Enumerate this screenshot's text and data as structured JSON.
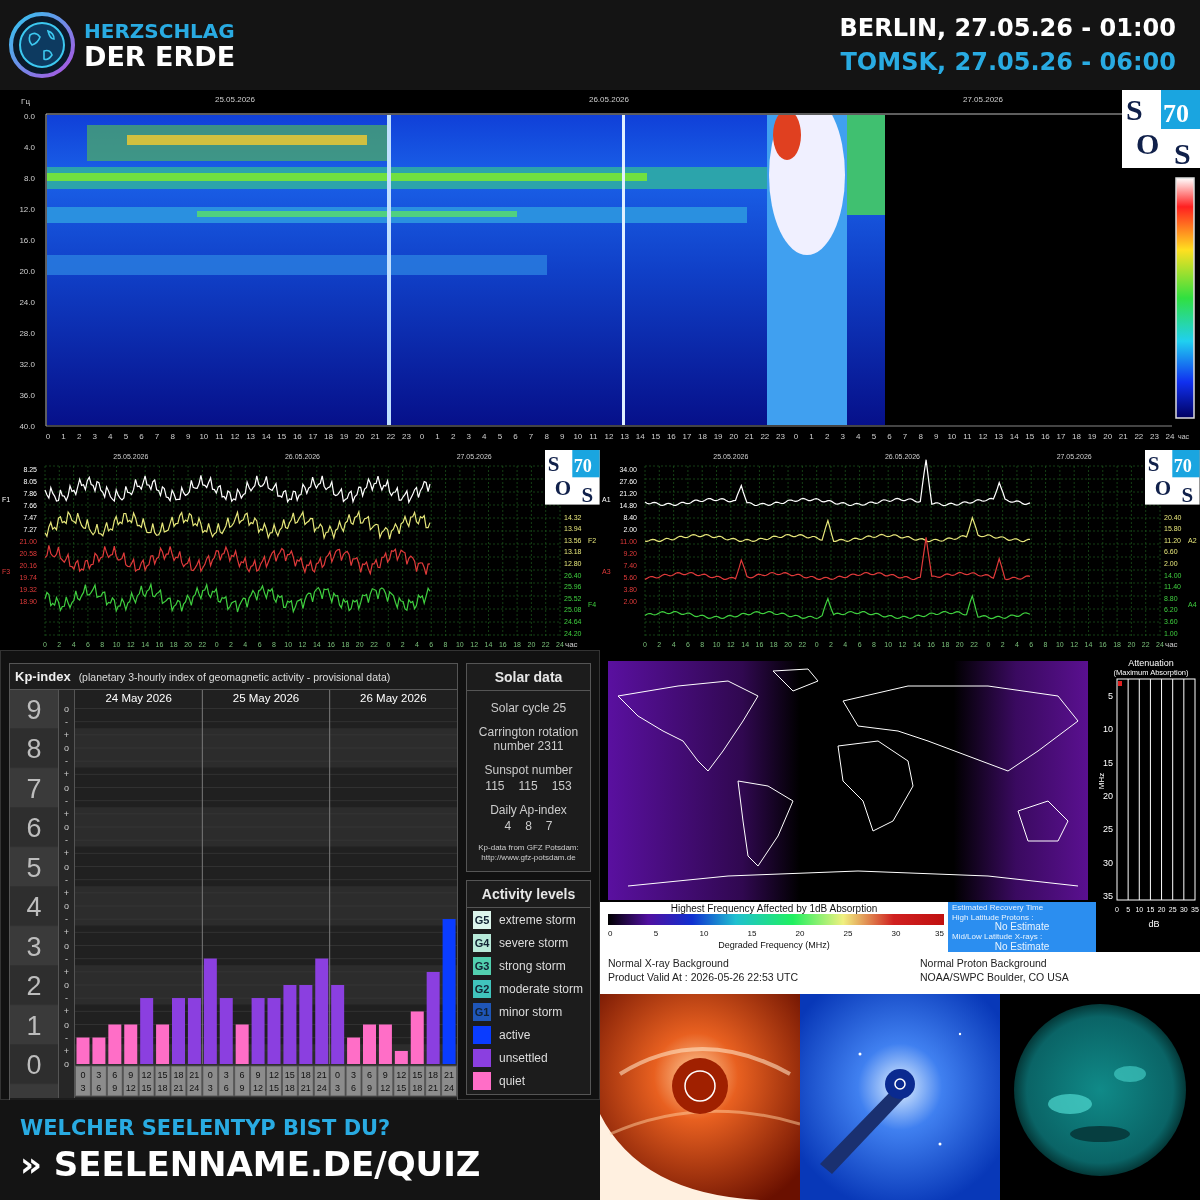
{
  "header": {
    "logo_lines": [
      "HERZSCHLAG",
      "DER ERDE"
    ],
    "times": [
      {
        "text": "BERLIN, 27.05.26 - 01:00",
        "color": "#ffffff"
      },
      {
        "text": "TOMSK, 27.05.26 - 06:00",
        "color": "#29abe2"
      }
    ]
  },
  "spectrogram": {
    "unit": "Гц",
    "dates": [
      "25.05.2026",
      "26.05.2026",
      "27.05.2026"
    ],
    "yticks": [
      "0.0",
      "4.0",
      "8.0",
      "12.0",
      "16.0",
      "20.0",
      "24.0",
      "28.0",
      "32.0",
      "36.0",
      "40.0"
    ],
    "xticks": [
      "0",
      "1",
      "2",
      "3",
      "4",
      "5",
      "6",
      "7",
      "8",
      "9",
      "10",
      "11",
      "12",
      "13",
      "14",
      "15",
      "16",
      "17",
      "18",
      "19",
      "20",
      "21",
      "22",
      "23",
      "0",
      "1",
      "2",
      "3",
      "4",
      "5",
      "6",
      "7",
      "8",
      "9",
      "10",
      "11",
      "12",
      "13",
      "14",
      "15",
      "16",
      "17",
      "18",
      "19",
      "20",
      "21",
      "22",
      "23",
      "0",
      "1",
      "2",
      "3",
      "4",
      "5",
      "6",
      "7",
      "8",
      "9",
      "10",
      "11",
      "12",
      "13",
      "14",
      "15",
      "16",
      "17",
      "18",
      "19",
      "20",
      "21",
      "22",
      "23",
      "24"
    ],
    "xunit": "час",
    "logo": [
      "S",
      "70",
      "O",
      "S"
    ]
  },
  "signal_charts": [
    {
      "dates": [
        "25.05.2026",
        "26.05.2026",
        "27.05.2026"
      ],
      "left_axes": [
        {
          "label": "F1",
          "color": "#ffffff",
          "ticks": [
            "8.25",
            "8.05",
            "7.86",
            "7.66",
            "7.47",
            "7.27"
          ]
        },
        {
          "label": "F3",
          "color": "#e03a3a",
          "ticks": [
            "21.00",
            "20.58",
            "20.16",
            "19.74",
            "19.32",
            "18.90"
          ]
        }
      ],
      "right_axes": [
        {
          "label": "F2",
          "color": "#e6e67a",
          "ticks": [
            "14.32",
            "13.94",
            "13.56",
            "13.18",
            "12.80"
          ]
        },
        {
          "label": "F4",
          "color": "#3fcf3f",
          "ticks": [
            "26.40",
            "25.96",
            "25.52",
            "25.08",
            "24.64",
            "24.20"
          ]
        }
      ],
      "xticks": [
        "0",
        "2",
        "4",
        "6",
        "8",
        "10",
        "12",
        "14",
        "16",
        "18",
        "20",
        "22",
        "0",
        "2",
        "4",
        "6",
        "8",
        "10",
        "12",
        "14",
        "16",
        "18",
        "20",
        "22",
        "0",
        "2",
        "4",
        "6",
        "8",
        "10",
        "12",
        "14",
        "16",
        "18",
        "20",
        "22",
        "24"
      ],
      "xunit": "час",
      "logo": [
        "S",
        "70",
        "O",
        "S"
      ]
    },
    {
      "dates": [
        "25.05.2026",
        "26.05.2026",
        "27.05.2026"
      ],
      "left_axes": [
        {
          "label": "A1",
          "color": "#ffffff",
          "ticks": [
            "34.00",
            "27.60",
            "21.20",
            "14.80",
            "8.40",
            "2.00"
          ]
        },
        {
          "label": "A3",
          "color": "#e03a3a",
          "ticks": [
            "11.00",
            "9.20",
            "7.40",
            "5.60",
            "3.80",
            "2.00"
          ]
        }
      ],
      "right_axes": [
        {
          "label": "A2",
          "color": "#e6e67a",
          "ticks": [
            "20.40",
            "15.80",
            "11.20",
            "6.60",
            "2.00"
          ]
        },
        {
          "label": "A4",
          "color": "#3fcf3f",
          "ticks": [
            "14.00",
            "11.40",
            "8.80",
            "6.20",
            "3.60",
            "1.00"
          ]
        }
      ],
      "xticks": [
        "0",
        "2",
        "4",
        "6",
        "8",
        "10",
        "12",
        "14",
        "16",
        "18",
        "20",
        "22",
        "0",
        "2",
        "4",
        "6",
        "8",
        "10",
        "12",
        "14",
        "16",
        "18",
        "20",
        "22",
        "0",
        "2",
        "4",
        "6",
        "8",
        "10",
        "12",
        "14",
        "16",
        "18",
        "20",
        "22",
        "24"
      ],
      "xunit": "час",
      "logo": [
        "S",
        "70",
        "O",
        "S"
      ]
    }
  ],
  "kp": {
    "title": "Kp-index",
    "subtitle": "(planetary 3-hourly index of geomagnetic activity - provisional data)",
    "day_labels": [
      "24 May 2026",
      "25 May 2026",
      "26 May 2026"
    ],
    "minor_marks": [
      "o",
      "-",
      "+",
      "o",
      "-",
      "+",
      "o",
      "-",
      "+",
      "o",
      "-",
      "+",
      "o",
      "-",
      "+",
      "o",
      "-",
      "+",
      "o",
      "-",
      "+",
      "o",
      "-",
      "+",
      "o",
      "-",
      "+",
      "o"
    ],
    "chart_data": {
      "type": "bar",
      "grid": true,
      "categories": [
        "0\n3",
        "3\n6",
        "6\n9",
        "9\n12",
        "12\n15",
        "15\n18",
        "18\n21",
        "21\n24",
        "0\n3",
        "3\n6",
        "6\n9",
        "9\n12",
        "12\n15",
        "15\n18",
        "18\n21",
        "21\n24",
        "0\n3",
        "3\n6",
        "6\n9",
        "9\n12",
        "12\n15",
        "15\n18",
        "18\n21",
        "21\n24"
      ],
      "series": [
        {
          "color": "#ff6ec7",
          "values": [
            0.67,
            0.67,
            1,
            1,
            null,
            1,
            null,
            null,
            null,
            null,
            1,
            null,
            null,
            null,
            null,
            null,
            null,
            0.67,
            1,
            1,
            0.33,
            1.33,
            null,
            null
          ]
        },
        {
          "color": "#8b3fe0",
          "values": [
            null,
            null,
            null,
            null,
            1.67,
            null,
            1.67,
            1.67,
            2.67,
            1.67,
            null,
            1.67,
            1.67,
            2,
            2,
            2.67,
            2,
            null,
            null,
            null,
            null,
            null,
            2.33,
            null
          ]
        },
        {
          "color": "#0a3cff",
          "values": [
            null,
            null,
            null,
            null,
            null,
            null,
            null,
            null,
            null,
            null,
            null,
            null,
            null,
            null,
            null,
            null,
            null,
            null,
            null,
            null,
            null,
            null,
            null,
            3.67
          ]
        }
      ],
      "ylim": [
        0,
        9
      ],
      "yticks": [
        0,
        1,
        2,
        3,
        4,
        5,
        6,
        7,
        8,
        9
      ]
    }
  },
  "solar": {
    "title": "Solar data",
    "items": [
      {
        "heading": "Solar cycle 25"
      },
      {
        "heading": "Carrington rotation number 2311"
      },
      {
        "heading": "Sunspot number",
        "values": [
          "115",
          "115",
          "153"
        ]
      },
      {
        "heading": "Daily Ap-index",
        "values": [
          "4",
          "8",
          "7"
        ]
      }
    ],
    "source": [
      "Kp-data from GFZ Potsdam:",
      "http://www.gfz-potsdam.de"
    ]
  },
  "activity": {
    "title": "Activity levels",
    "levels": [
      {
        "badge": "G5",
        "label": "extreme storm",
        "color": "#dcf5ec"
      },
      {
        "badge": "G4",
        "label": "severe storm",
        "color": "#b8ead9"
      },
      {
        "badge": "G3",
        "label": "strong storm",
        "color": "#52cfae"
      },
      {
        "badge": "G2",
        "label": "moderate storm",
        "color": "#40c4bd"
      },
      {
        "badge": "G1",
        "label": "minor storm",
        "color": "#1f56b8"
      },
      {
        "label": "active",
        "color": "#0a3cff"
      },
      {
        "label": "unsettled",
        "color": "#8b3fe0"
      },
      {
        "label": "quiet",
        "color": "#ff6ec7"
      }
    ]
  },
  "quiz": {
    "question": "WELCHER SEELENTYP BIST DU?",
    "link": "» SEELENNAME.DE/QUIZ"
  },
  "absorption": {
    "attenuation": {
      "title": "Attenuation",
      "subtitle": "(Maximum Absorption)",
      "yunit": "MHz",
      "yticks": [
        "5",
        "10",
        "15",
        "20",
        "25",
        "30",
        "35"
      ],
      "xticks": [
        "0",
        "5",
        "10",
        "15",
        "20",
        "25",
        "30",
        "35"
      ],
      "xunit": "dB"
    },
    "scale": {
      "title": "Highest Frequency Affected by 1dB Absorption",
      "ticks": [
        "0",
        "5",
        "10",
        "15",
        "20",
        "25",
        "30",
        "35"
      ],
      "xlabel": "Degraded Frequency (MHz)"
    },
    "recovery": {
      "title": "Estimated Recovery Time",
      "rows": [
        {
          "label": "High Latitude Protons :",
          "value": "No Estimate"
        },
        {
          "label": "Mid/Low Latitude X-rays :",
          "value": "No Estimate"
        }
      ]
    },
    "status": {
      "left": [
        "Normal X-ray Background",
        "Product Valid At : 2026-05-26 22:53 UTC"
      ],
      "right": [
        "Normal Proton Background",
        "NOAA/SWPC Boulder, CO USA"
      ]
    }
  }
}
